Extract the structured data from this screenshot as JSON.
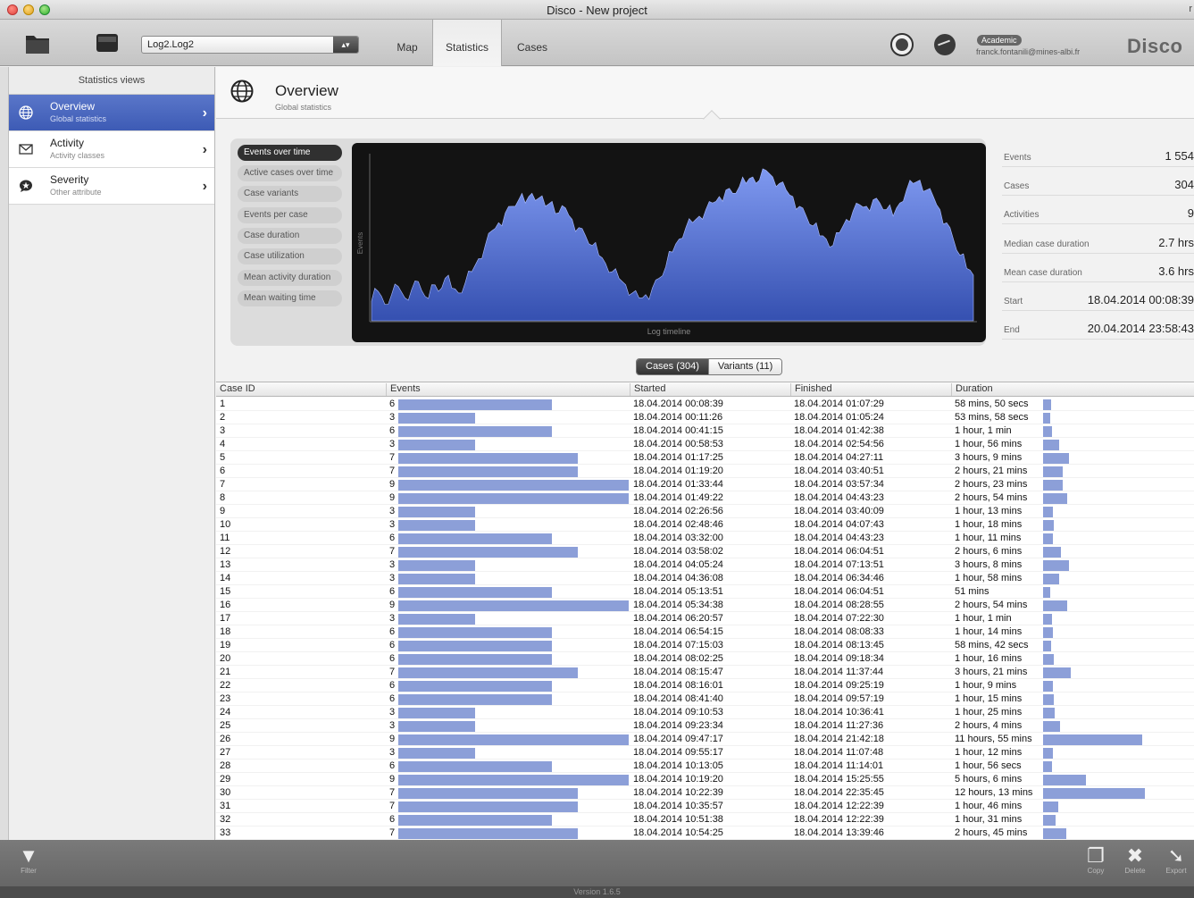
{
  "window": {
    "title": "Disco - New project",
    "corner": "r"
  },
  "toolbar": {
    "log_select": "Log2.Log2",
    "tabs": [
      {
        "label": "Map"
      },
      {
        "label": "Statistics"
      },
      {
        "label": "Cases"
      }
    ],
    "active_tab": "Statistics",
    "badge": "Academic",
    "email": "franck.fontanili@mines-albi.fr",
    "brand": "Disco"
  },
  "sidebar": {
    "header": "Statistics views",
    "items": [
      {
        "title": "Overview",
        "sub": "Global statistics",
        "icon": "globe-icon",
        "active": true
      },
      {
        "title": "Activity",
        "sub": "Activity classes",
        "icon": "envelope-icon",
        "active": false
      },
      {
        "title": "Severity",
        "sub": "Other attribute",
        "icon": "star-bubble-icon",
        "active": false
      }
    ]
  },
  "overview": {
    "title": "Overview",
    "subtitle": "Global statistics"
  },
  "metrics": [
    "Events over time",
    "Active cases over time",
    "Case variants",
    "Events per case",
    "Case duration",
    "Case utilization",
    "Mean activity duration",
    "Mean waiting time"
  ],
  "active_metric": "Events over time",
  "chart_data": {
    "type": "area",
    "xlabel": "Log timeline",
    "ylabel": "Events",
    "grid": false,
    "values": [
      0.12,
      0.18,
      0.1,
      0.16,
      0.21,
      0.14,
      0.19,
      0.24,
      0.15,
      0.22,
      0.18,
      0.26,
      0.2,
      0.17,
      0.23,
      0.3,
      0.38,
      0.46,
      0.55,
      0.6,
      0.66,
      0.7,
      0.74,
      0.72,
      0.78,
      0.75,
      0.7,
      0.73,
      0.66,
      0.69,
      0.62,
      0.57,
      0.52,
      0.46,
      0.4,
      0.35,
      0.3,
      0.26,
      0.22,
      0.17,
      0.14,
      0.16,
      0.2,
      0.26,
      0.33,
      0.42,
      0.5,
      0.57,
      0.6,
      0.64,
      0.68,
      0.72,
      0.76,
      0.8,
      0.78,
      0.82,
      0.84,
      0.88,
      0.86,
      0.92,
      0.88,
      0.84,
      0.8,
      0.76,
      0.7,
      0.64,
      0.58,
      0.52,
      0.5,
      0.46,
      0.54,
      0.62,
      0.67,
      0.71,
      0.7,
      0.74,
      0.72,
      0.68,
      0.64,
      0.72,
      0.8,
      0.84,
      0.86,
      0.8,
      0.76,
      0.68,
      0.6,
      0.5,
      0.4,
      0.32,
      0.28
    ]
  },
  "stats": [
    {
      "label": "Events",
      "value": "1 554"
    },
    {
      "label": "Cases",
      "value": "304"
    },
    {
      "label": "Activities",
      "value": "9"
    },
    {
      "label": "Median case duration",
      "value": "2.7 hrs"
    },
    {
      "label": "Mean case duration",
      "value": "3.6 hrs"
    },
    {
      "label": "Start",
      "value": "18.04.2014 00:08:39"
    },
    {
      "label": "End",
      "value": "20.04.2014 23:58:43"
    }
  ],
  "switch": {
    "cases": "Cases (304)",
    "variants": "Variants (11)"
  },
  "table": {
    "columns": [
      "Case ID",
      "Events",
      "Started",
      "Finished",
      "Duration"
    ],
    "rows": [
      {
        "id": "1",
        "events": 6,
        "started": "18.04.2014 00:08:39",
        "finished": "18.04.2014 01:07:29",
        "duration": "58 mins, 50 secs",
        "hours": 0.98
      },
      {
        "id": "2",
        "events": 3,
        "started": "18.04.2014 00:11:26",
        "finished": "18.04.2014 01:05:24",
        "duration": "53 mins, 58 secs",
        "hours": 0.9
      },
      {
        "id": "3",
        "events": 6,
        "started": "18.04.2014 00:41:15",
        "finished": "18.04.2014 01:42:38",
        "duration": "1 hour, 1 min",
        "hours": 1.02
      },
      {
        "id": "4",
        "events": 3,
        "started": "18.04.2014 00:58:53",
        "finished": "18.04.2014 02:54:56",
        "duration": "1 hour, 56 mins",
        "hours": 1.93
      },
      {
        "id": "5",
        "events": 7,
        "started": "18.04.2014 01:17:25",
        "finished": "18.04.2014 04:27:11",
        "duration": "3 hours, 9 mins",
        "hours": 3.15
      },
      {
        "id": "6",
        "events": 7,
        "started": "18.04.2014 01:19:20",
        "finished": "18.04.2014 03:40:51",
        "duration": "2 hours, 21 mins",
        "hours": 2.35
      },
      {
        "id": "7",
        "events": 9,
        "started": "18.04.2014 01:33:44",
        "finished": "18.04.2014 03:57:34",
        "duration": "2 hours, 23 mins",
        "hours": 2.38
      },
      {
        "id": "8",
        "events": 9,
        "started": "18.04.2014 01:49:22",
        "finished": "18.04.2014 04:43:23",
        "duration": "2 hours, 54 mins",
        "hours": 2.9
      },
      {
        "id": "9",
        "events": 3,
        "started": "18.04.2014 02:26:56",
        "finished": "18.04.2014 03:40:09",
        "duration": "1 hour, 13 mins",
        "hours": 1.22
      },
      {
        "id": "10",
        "events": 3,
        "started": "18.04.2014 02:48:46",
        "finished": "18.04.2014 04:07:43",
        "duration": "1 hour, 18 mins",
        "hours": 1.3
      },
      {
        "id": "11",
        "events": 6,
        "started": "18.04.2014 03:32:00",
        "finished": "18.04.2014 04:43:23",
        "duration": "1 hour, 11 mins",
        "hours": 1.18
      },
      {
        "id": "12",
        "events": 7,
        "started": "18.04.2014 03:58:02",
        "finished": "18.04.2014 06:04:51",
        "duration": "2 hours, 6 mins",
        "hours": 2.1
      },
      {
        "id": "13",
        "events": 3,
        "started": "18.04.2014 04:05:24",
        "finished": "18.04.2014 07:13:51",
        "duration": "3 hours, 8 mins",
        "hours": 3.13
      },
      {
        "id": "14",
        "events": 3,
        "started": "18.04.2014 04:36:08",
        "finished": "18.04.2014 06:34:46",
        "duration": "1 hour, 58 mins",
        "hours": 1.97
      },
      {
        "id": "15",
        "events": 6,
        "started": "18.04.2014 05:13:51",
        "finished": "18.04.2014 06:04:51",
        "duration": "51 mins",
        "hours": 0.85
      },
      {
        "id": "16",
        "events": 9,
        "started": "18.04.2014 05:34:38",
        "finished": "18.04.2014 08:28:55",
        "duration": "2 hours, 54 mins",
        "hours": 2.9
      },
      {
        "id": "17",
        "events": 3,
        "started": "18.04.2014 06:20:57",
        "finished": "18.04.2014 07:22:30",
        "duration": "1 hour, 1 min",
        "hours": 1.02
      },
      {
        "id": "18",
        "events": 6,
        "started": "18.04.2014 06:54:15",
        "finished": "18.04.2014 08:08:33",
        "duration": "1 hour, 14 mins",
        "hours": 1.23
      },
      {
        "id": "19",
        "events": 6,
        "started": "18.04.2014 07:15:03",
        "finished": "18.04.2014 08:13:45",
        "duration": "58 mins, 42 secs",
        "hours": 0.98
      },
      {
        "id": "20",
        "events": 6,
        "started": "18.04.2014 08:02:25",
        "finished": "18.04.2014 09:18:34",
        "duration": "1 hour, 16 mins",
        "hours": 1.27
      },
      {
        "id": "21",
        "events": 7,
        "started": "18.04.2014 08:15:47",
        "finished": "18.04.2014 11:37:44",
        "duration": "3 hours, 21 mins",
        "hours": 3.35
      },
      {
        "id": "22",
        "events": 6,
        "started": "18.04.2014 08:16:01",
        "finished": "18.04.2014 09:25:19",
        "duration": "1 hour, 9 mins",
        "hours": 1.15
      },
      {
        "id": "23",
        "events": 6,
        "started": "18.04.2014 08:41:40",
        "finished": "18.04.2014 09:57:19",
        "duration": "1 hour, 15 mins",
        "hours": 1.25
      },
      {
        "id": "24",
        "events": 3,
        "started": "18.04.2014 09:10:53",
        "finished": "18.04.2014 10:36:41",
        "duration": "1 hour, 25 mins",
        "hours": 1.42
      },
      {
        "id": "25",
        "events": 3,
        "started": "18.04.2014 09:23:34",
        "finished": "18.04.2014 11:27:36",
        "duration": "2 hours, 4 mins",
        "hours": 2.07
      },
      {
        "id": "26",
        "events": 9,
        "started": "18.04.2014 09:47:17",
        "finished": "18.04.2014 21:42:18",
        "duration": "11 hours, 55 mins",
        "hours": 11.92
      },
      {
        "id": "27",
        "events": 3,
        "started": "18.04.2014 09:55:17",
        "finished": "18.04.2014 11:07:48",
        "duration": "1 hour, 12 mins",
        "hours": 1.2
      },
      {
        "id": "28",
        "events": 6,
        "started": "18.04.2014 10:13:05",
        "finished": "18.04.2014 11:14:01",
        "duration": "1 hour, 56 secs",
        "hours": 1.02
      },
      {
        "id": "29",
        "events": 9,
        "started": "18.04.2014 10:19:20",
        "finished": "18.04.2014 15:25:55",
        "duration": "5 hours, 6 mins",
        "hours": 5.1
      },
      {
        "id": "30",
        "events": 7,
        "started": "18.04.2014 10:22:39",
        "finished": "18.04.2014 22:35:45",
        "duration": "12 hours, 13 mins",
        "hours": 12.22
      },
      {
        "id": "31",
        "events": 7,
        "started": "18.04.2014 10:35:57",
        "finished": "18.04.2014 12:22:39",
        "duration": "1 hour, 46 mins",
        "hours": 1.77
      },
      {
        "id": "32",
        "events": 6,
        "started": "18.04.2014 10:51:38",
        "finished": "18.04.2014 12:22:39",
        "duration": "1 hour, 31 mins",
        "hours": 1.52
      },
      {
        "id": "33",
        "events": 7,
        "started": "18.04.2014 10:54:25",
        "finished": "18.04.2014 13:39:46",
        "duration": "2 hours, 45 mins",
        "hours": 2.75
      }
    ]
  },
  "bottom": {
    "filter": "Filter",
    "copy": "Copy",
    "delete": "Delete",
    "export": "Export"
  },
  "status": {
    "version": "Version 1.6.5"
  }
}
